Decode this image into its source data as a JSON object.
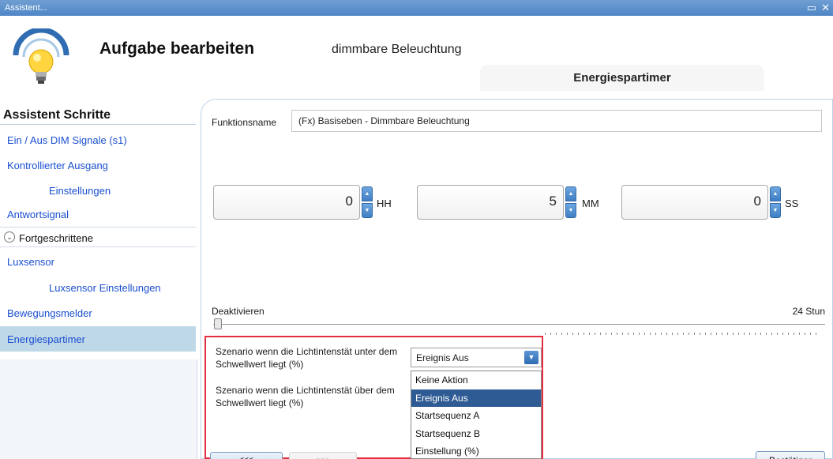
{
  "window": {
    "title": "Assistent...",
    "minimize_icon": "maximize-icon",
    "close_icon": "close-icon"
  },
  "header": {
    "title": "Aufgabe bearbeiten",
    "subtitle": "dimmbare Beleuchtung",
    "active_tab": "Energiespartimer",
    "logo_icon": "lightbulb-icon"
  },
  "sidebar": {
    "heading": "Assistent Schritte",
    "items": [
      {
        "label": "Ein / Aus DIM Signale (s1)"
      },
      {
        "label": "Kontrollierter Ausgang"
      },
      {
        "label": "Einstellungen"
      },
      {
        "label": "Antwortsignal"
      },
      {
        "label": "Fortgeschrittene"
      },
      {
        "label": "Luxsensor"
      },
      {
        "label": "Luxsensor Einstellungen"
      },
      {
        "label": "Bewegungsmelder"
      },
      {
        "label": "Energiespartimer"
      }
    ]
  },
  "form": {
    "function_label": "Funktionsname",
    "function_value": "(Fx) Basiseben - Dimmbare Beleuchtung",
    "time": {
      "hours": "0",
      "hours_unit": "HH",
      "minutes": "5",
      "minutes_unit": "MM",
      "seconds": "0",
      "seconds_unit": "SS"
    },
    "slider": {
      "min_label": "Deaktivieren",
      "max_label": "24 Stun",
      "value": 0
    },
    "scenario_below": "Szenario wenn die Lichtintenstät unter dem Schwellwert liegt (%)",
    "scenario_above": "Szenario wenn die Lichtintenstät über dem Schwellwert liegt (%)",
    "select_value": "Ereignis Aus",
    "dropdown_options": [
      "Keine Aktion",
      "Ereignis Aus",
      "Startsequenz A",
      "Startsequenz B",
      "Einstellung (%)"
    ]
  },
  "buttons": {
    "back": "<<<",
    "next": ">>>",
    "confirm": "Bestätiger"
  },
  "colors": {
    "titlebar": "#4f86c6",
    "accent": "#2f6cb2",
    "link": "#1a4fd0",
    "highlight": "#e23040",
    "active_item": "#bfd8e8"
  }
}
